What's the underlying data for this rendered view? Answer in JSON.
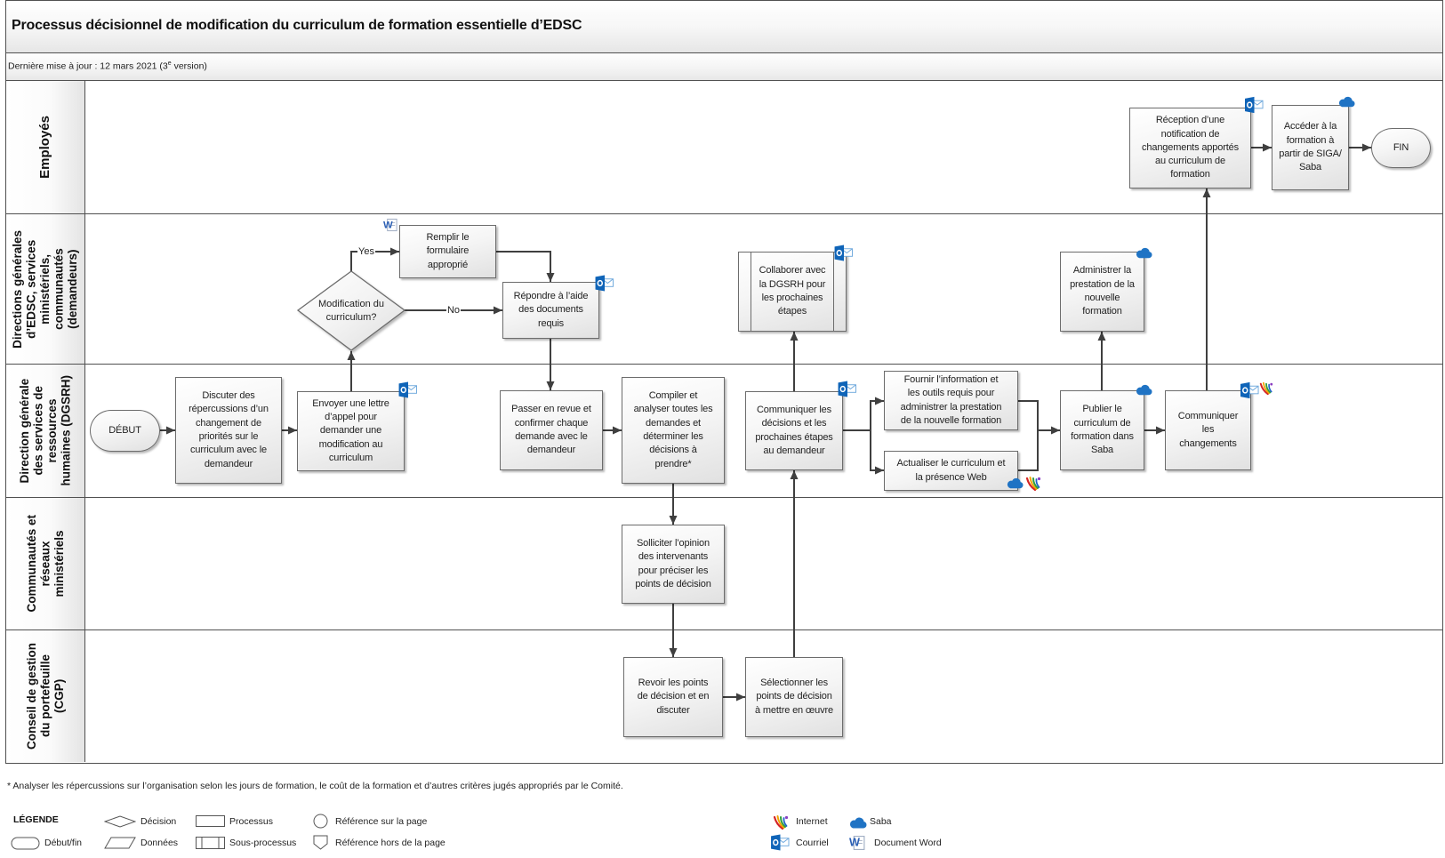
{
  "header": {
    "title": "Processus décisionnel de modification du curriculum de formation essentielle d’EDSC",
    "last_updated_prefix": "Dernière mise à jour : 12 mars 2021 (3",
    "last_updated_sup": "e",
    "last_updated_suffix": " version)"
  },
  "lanes": [
    {
      "label": "Employés"
    },
    {
      "label": "Directions générales\nd’EDSC, services\nministériels,\ncommunautés\n(demandeurs)"
    },
    {
      "label": "Direction générale\ndes services de\nressources\nhumaines (DGSRH)"
    },
    {
      "label": "Communautés et\nréseaux\nministériels"
    },
    {
      "label": "Conseil de gestion\ndu portefeuille\n(CGP)"
    }
  ],
  "nodes": {
    "debut": "DÉBUT",
    "discuter": "Discuter des\nrépercussions d’un\nchangement de\npriorités sur le\ncurriculum avec le\ndemandeur",
    "envoyer": "Envoyer une lettre\nd’appel pour\ndemander une\nmodification au\ncurriculum",
    "decision": "Modification du\ncurriculum?",
    "remplir": "Remplir le\nformulaire\napproprié",
    "repondre": "Répondre à l’aide\ndes documents\nrequis",
    "passer": "Passer en revue et\nconfirmer chaque\ndemande avec le\ndemandeur",
    "compiler": "Compiler et\nanalyser toutes les\ndemandes et\ndéterminer les\ndécisions à\nprendre*",
    "solliciter": "Solliciter l’opinion\ndes intervenants\npour préciser les\npoints de décision",
    "revoir": "Revoir les points\nde décision et en\ndiscuter",
    "selectionner": "Sélectionner les\npoints de décision\nà mettre en œuvre",
    "communiquer_decisions": "Communiquer les\ndécisions et les\nprochaines étapes\nau demandeur",
    "collaborer": "Collaborer avec\nla DGSRH pour\nles prochaines\nétapes",
    "fournir": "Fournir l’information et\nles outils requis pour\nadministrer la prestation\nde la nouvelle formation",
    "actualiser": "Actualiser le curriculum et\nla présence Web",
    "publier": "Publier le\ncurriculum de\nformation dans\nSaba",
    "administrer": "Administrer la\nprestation de la\nnouvelle\nformation",
    "communiquer_changements": "Communiquer\nles\nchangements",
    "reception": "Réception d’une\nnotification de\nchangements apportés\nau curriculum de\nformation",
    "acceder": "Accéder à la\nformation à\npartir de SIGA/\nSaba",
    "fin": "FIN"
  },
  "connector_labels": {
    "yes": "Yes",
    "no": "No"
  },
  "node_icons": {
    "remplir": [
      "word-document-icon"
    ],
    "repondre": [
      "courriel-outlook-icon"
    ],
    "envoyer": [
      "courriel-outlook-icon"
    ],
    "collaborer": [
      "courriel-outlook-icon"
    ],
    "communiquer_decisions": [
      "courriel-outlook-icon"
    ],
    "actualiser": [
      "saba-cloud-icon",
      "internet-icon"
    ],
    "publier": [
      "saba-cloud-icon"
    ],
    "administrer": [
      "saba-cloud-icon"
    ],
    "communiquer_changements": [
      "courriel-outlook-icon",
      "internet-icon"
    ],
    "reception": [
      "courriel-outlook-icon"
    ],
    "acceder": [
      "saba-cloud-icon"
    ]
  },
  "footnote": "* Analyser les répercussions sur l’organisation selon les jours de formation, le coût de la formation et d’autres critères jugés appropriés par le Comité.",
  "legend": {
    "title": "LÉGENDE",
    "shapes": [
      {
        "shape": "start-end",
        "label": "Début/fin"
      },
      {
        "shape": "decision",
        "label": "Décision"
      },
      {
        "shape": "data",
        "label": "Données"
      },
      {
        "shape": "process",
        "label": "Processus"
      },
      {
        "shape": "sub-process",
        "label": "Sous-processus"
      },
      {
        "shape": "on-page-reference",
        "label": "Référence sur la page"
      },
      {
        "shape": "off-page-reference",
        "label": "Référence hors de la page"
      }
    ],
    "icons": [
      {
        "icon": "internet-icon",
        "label": "Internet"
      },
      {
        "icon": "saba-cloud-icon",
        "label": "Saba"
      },
      {
        "icon": "courriel-outlook-icon",
        "label": "Courriel"
      },
      {
        "icon": "word-document-icon",
        "label": "Document Word"
      }
    ]
  },
  "colors": {
    "outlook_blue": "#0f64b8",
    "saba_cloud_blue": "#1f73c4",
    "word_blue": "#2b5fb4",
    "line_dark": "#3f3f3f"
  }
}
